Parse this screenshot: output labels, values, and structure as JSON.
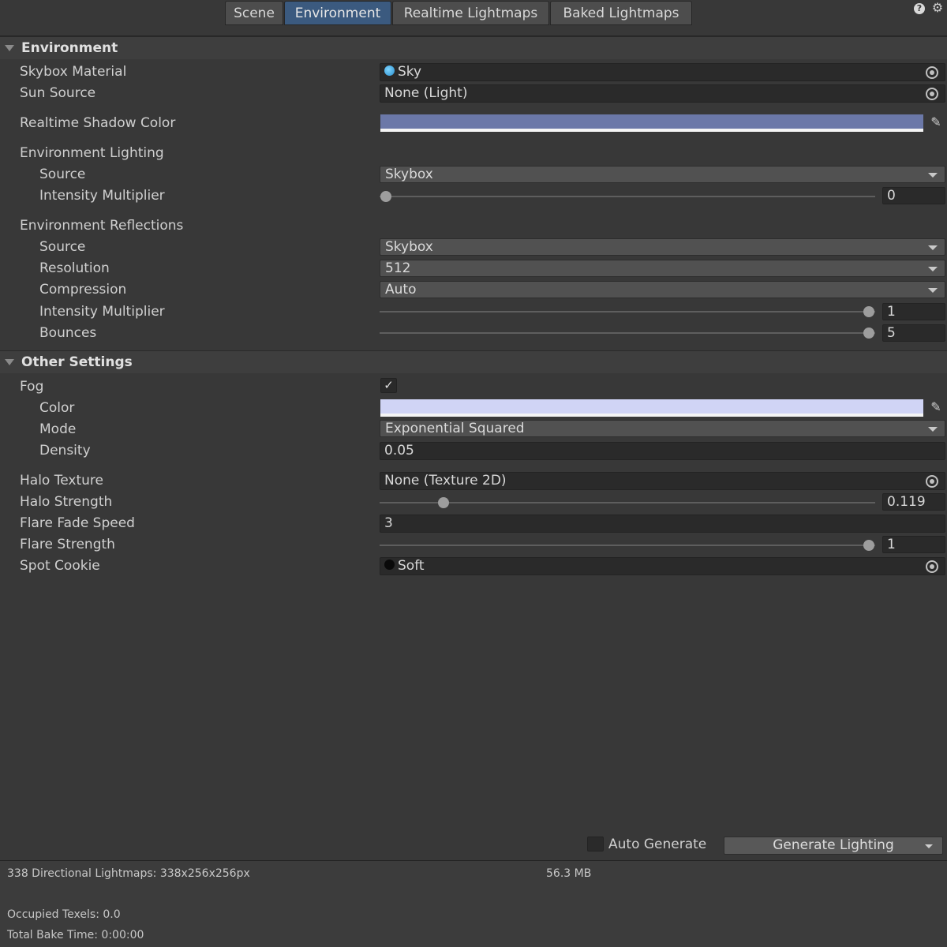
{
  "tabs": [
    {
      "label": "Scene",
      "active": false
    },
    {
      "label": "Environment",
      "active": true
    },
    {
      "label": "Realtime Lightmaps",
      "active": false
    },
    {
      "label": "Baked Lightmaps",
      "active": false
    }
  ],
  "top_icons": {
    "help": "?",
    "settings": "gear-icon"
  },
  "environment": {
    "header": "Environment",
    "skybox_material": {
      "label": "Skybox Material",
      "value": "Sky"
    },
    "sun_source": {
      "label": "Sun Source",
      "value": "None (Light)"
    },
    "realtime_shadow_color": {
      "label": "Realtime Shadow Color",
      "color": "#6b78a8"
    },
    "lighting": {
      "label": "Environment Lighting",
      "source": {
        "label": "Source",
        "value": "Skybox"
      },
      "intensity": {
        "label": "Intensity Multiplier",
        "value": "0",
        "level": 0
      }
    },
    "reflections": {
      "label": "Environment Reflections",
      "source": {
        "label": "Source",
        "value": "Skybox"
      },
      "resolution": {
        "label": "Resolution",
        "value": "512"
      },
      "compression": {
        "label": "Compression",
        "value": "Auto"
      },
      "intensity": {
        "label": "Intensity Multiplier",
        "value": "1",
        "level": 1
      },
      "bounces": {
        "label": "Bounces",
        "value": "5",
        "level": 1
      }
    }
  },
  "other": {
    "header": "Other Settings",
    "fog": {
      "label": "Fog",
      "checked": true,
      "check_glyph": "✓"
    },
    "fog_color": {
      "label": "Color",
      "color": "#d0d4f5"
    },
    "fog_mode": {
      "label": "Mode",
      "value": "Exponential Squared"
    },
    "fog_density": {
      "label": "Density",
      "value": "0.05"
    },
    "halo_texture": {
      "label": "Halo Texture",
      "value": "None (Texture 2D)"
    },
    "halo_strength": {
      "label": "Halo Strength",
      "value": "0.119",
      "level": 0.119
    },
    "flare_fade_speed": {
      "label": "Flare Fade Speed",
      "value": "3"
    },
    "flare_strength": {
      "label": "Flare Strength",
      "value": "1",
      "level": 1
    },
    "spot_cookie": {
      "label": "Spot Cookie",
      "value": "Soft"
    }
  },
  "bottom": {
    "auto_generate": {
      "label": "Auto Generate",
      "checked": false
    },
    "generate_button": "Generate Lighting"
  },
  "status": {
    "lightmaps": "338 Directional Lightmaps: 338x256x256px",
    "size": "56.3 MB",
    "occupied": "Occupied Texels: 0.0",
    "bake_time": "Total Bake Time: 0:00:00"
  },
  "colors": {
    "accent_tab": "#3b5a7f",
    "sky_icon": "#4fb3ea"
  }
}
